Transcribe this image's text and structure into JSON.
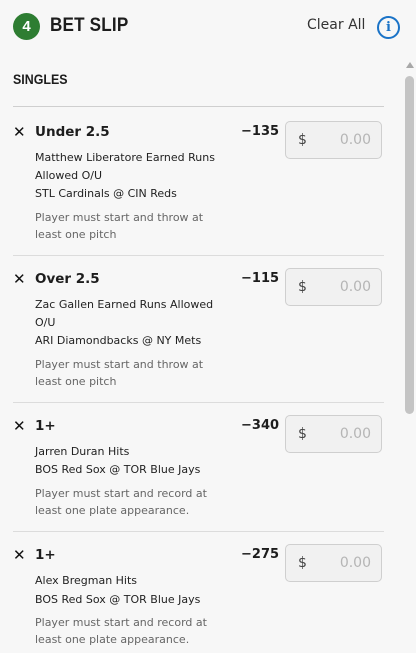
{
  "header": {
    "count": "4",
    "title": "BET SLIP",
    "clear_all": "Clear All",
    "info_icon": "info-icon"
  },
  "section": {
    "title": "SINGLES"
  },
  "bets": [
    {
      "selection": "Under 2.5",
      "odds": "−135",
      "market": "Matthew Liberatore Earned Runs Allowed O/U",
      "event": "STL Cardinals @ CIN Reds",
      "note": "Player must start and throw at least one pitch",
      "currency": "$",
      "stake_placeholder": "0.00"
    },
    {
      "selection": "Over 2.5",
      "odds": "−115",
      "market": "Zac Gallen Earned Runs Allowed O/U",
      "event": "ARI Diamondbacks @ NY Mets",
      "note": "Player must start and throw at least one pitch",
      "currency": "$",
      "stake_placeholder": "0.00"
    },
    {
      "selection": "1+",
      "odds": "−340",
      "market": "Jarren Duran Hits",
      "event": "BOS Red Sox @ TOR Blue Jays",
      "note": "Player must start and record at least one plate appearance.",
      "currency": "$",
      "stake_placeholder": "0.00"
    },
    {
      "selection": "1+",
      "odds": "−275",
      "market": "Alex Bregman Hits",
      "event": "BOS Red Sox @ TOR Blue Jays",
      "note": "Player must start and record at least one plate appearance.",
      "currency": "$",
      "stake_placeholder": "0.00"
    }
  ],
  "colors": {
    "badge": "#2e7d32",
    "info": "#1a73c7",
    "background": "#f7f7f7"
  }
}
